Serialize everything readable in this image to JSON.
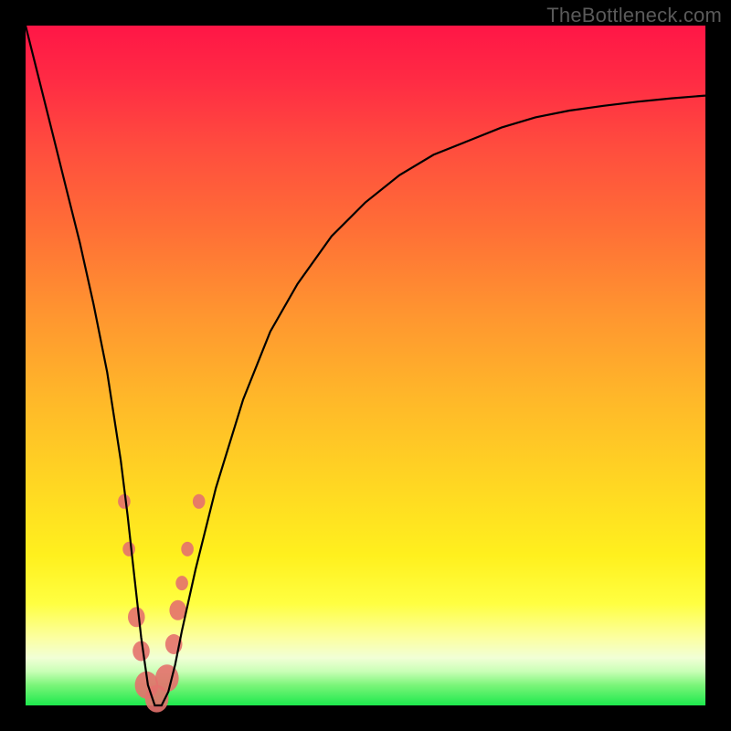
{
  "watermark": "TheBottleneck.com",
  "colors": {
    "frame": "#000000",
    "curve": "#000000",
    "marker": "#e4716d",
    "gradient_top": "#ff1646",
    "gradient_bottom": "#1de94d"
  },
  "chart_data": {
    "type": "line",
    "title": "",
    "xlabel": "",
    "ylabel": "",
    "xlim": [
      0,
      100
    ],
    "ylim": [
      0,
      100
    ],
    "series": [
      {
        "name": "bottleneck-curve",
        "x": [
          0,
          2,
          4,
          6,
          8,
          10,
          12,
          14,
          15,
          16,
          17,
          18,
          19,
          20,
          21,
          22,
          23,
          25,
          28,
          32,
          36,
          40,
          45,
          50,
          55,
          60,
          65,
          70,
          75,
          80,
          85,
          90,
          95,
          100
        ],
        "y": [
          100,
          92,
          84,
          76,
          68,
          59,
          49,
          36,
          28,
          19,
          10,
          3,
          0,
          0,
          2,
          6,
          11,
          20,
          32,
          45,
          55,
          62,
          69,
          74,
          78,
          81,
          83,
          85,
          86.5,
          87.5,
          88.2,
          88.8,
          89.3,
          89.7
        ]
      }
    ],
    "markers": [
      {
        "x": 14.5,
        "y": 30,
        "size": "small"
      },
      {
        "x": 15.2,
        "y": 23,
        "size": "small"
      },
      {
        "x": 16.3,
        "y": 13,
        "size": "medium"
      },
      {
        "x": 17.0,
        "y": 8,
        "size": "medium"
      },
      {
        "x": 17.8,
        "y": 3,
        "size": "large"
      },
      {
        "x": 19.3,
        "y": 1,
        "size": "large"
      },
      {
        "x": 20.8,
        "y": 4,
        "size": "large"
      },
      {
        "x": 21.8,
        "y": 9,
        "size": "medium"
      },
      {
        "x": 22.4,
        "y": 14,
        "size": "medium"
      },
      {
        "x": 23.0,
        "y": 18,
        "size": "small"
      },
      {
        "x": 23.8,
        "y": 23,
        "size": "small"
      },
      {
        "x": 25.5,
        "y": 30,
        "size": "small"
      }
    ],
    "notes": "Axis values are estimated on a 0–100 relative scale (no visible axes or ticks in the image). y represents height of the curve from bottom (0) to top (100). Minimum of the V sits near x≈18–20."
  }
}
